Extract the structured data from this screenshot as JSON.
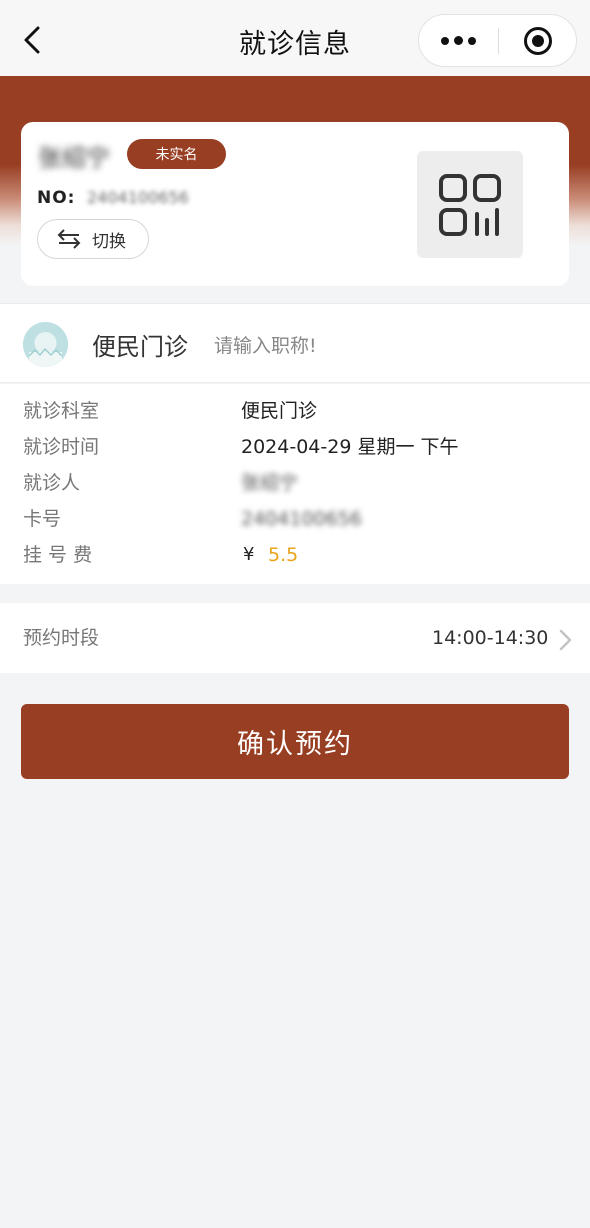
{
  "navbar": {
    "title": "就诊信息"
  },
  "card": {
    "patient_name": "张绍宁",
    "realname_badge": "未实名",
    "no_label": "NO:",
    "card_number": "2404100656",
    "switch_label": "切换"
  },
  "doctor": {
    "name": "便民门诊",
    "title_placeholder": "请输入职称!"
  },
  "info": [
    {
      "label": "就诊科室",
      "value": "便民门诊"
    },
    {
      "label": "就诊时间",
      "value": "2024-04-29 星期一 下午"
    },
    {
      "label": "就诊人",
      "value": "张绍宁"
    },
    {
      "label": "卡号",
      "value": "2404100656"
    },
    {
      "label": "挂 号 费",
      "currency": "¥",
      "value": "5.5"
    }
  ],
  "slot": {
    "label": "预约时段",
    "value": "14:00-14:30"
  },
  "confirm_label": "确认预约",
  "colors": {
    "brand": "#983e23",
    "fee": "#e8a41a"
  },
  "icons": [
    "back-icon",
    "more-icon",
    "close-miniapp-icon",
    "switch-icon",
    "qrcode-icon",
    "doctor-avatar",
    "chevron-right-icon"
  ]
}
